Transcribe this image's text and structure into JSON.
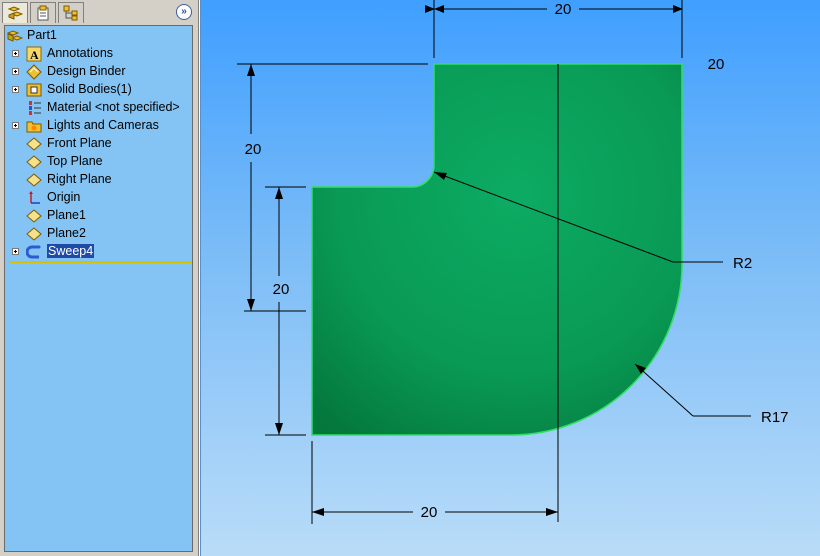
{
  "feature_tree": {
    "tabs": [
      "feature-manager-tab",
      "property-manager-tab",
      "configuration-manager-tab"
    ],
    "expand_glyph": "»",
    "root_label": "Part1",
    "items": [
      {
        "label": "Annotations",
        "icon": "annotations-icon",
        "expandable": true
      },
      {
        "label": "Design Binder",
        "icon": "design-binder-icon",
        "expandable": true
      },
      {
        "label": "Solid Bodies(1)",
        "icon": "solid-bodies-icon",
        "expandable": true
      },
      {
        "label": "Material <not specified>",
        "icon": "material-icon",
        "expandable": false
      },
      {
        "label": "Lights and Cameras",
        "icon": "lights-cameras-icon",
        "expandable": true
      },
      {
        "label": "Front Plane",
        "icon": "plane-icon",
        "expandable": false
      },
      {
        "label": "Top Plane",
        "icon": "plane-icon",
        "expandable": false
      },
      {
        "label": "Right Plane",
        "icon": "plane-icon",
        "expandable": false
      },
      {
        "label": "Origin",
        "icon": "origin-icon",
        "expandable": false
      },
      {
        "label": "Plane1",
        "icon": "plane-icon",
        "expandable": false
      },
      {
        "label": "Plane2",
        "icon": "plane-icon",
        "expandable": false
      },
      {
        "label": "Sweep4",
        "icon": "sweep-icon",
        "expandable": true,
        "selected": true
      }
    ]
  },
  "drawing": {
    "dimensions": {
      "top_width": "20",
      "top_right": "20",
      "left_height": "20",
      "inner_height": "20",
      "bottom_width": "20",
      "small_radius": "R2",
      "large_radius": "R17"
    },
    "colors": {
      "part_fill": "#0aa05a",
      "part_edge": "#33dd66",
      "background_top": "#3f9fff",
      "background_bottom": "#b9dcf8"
    }
  }
}
